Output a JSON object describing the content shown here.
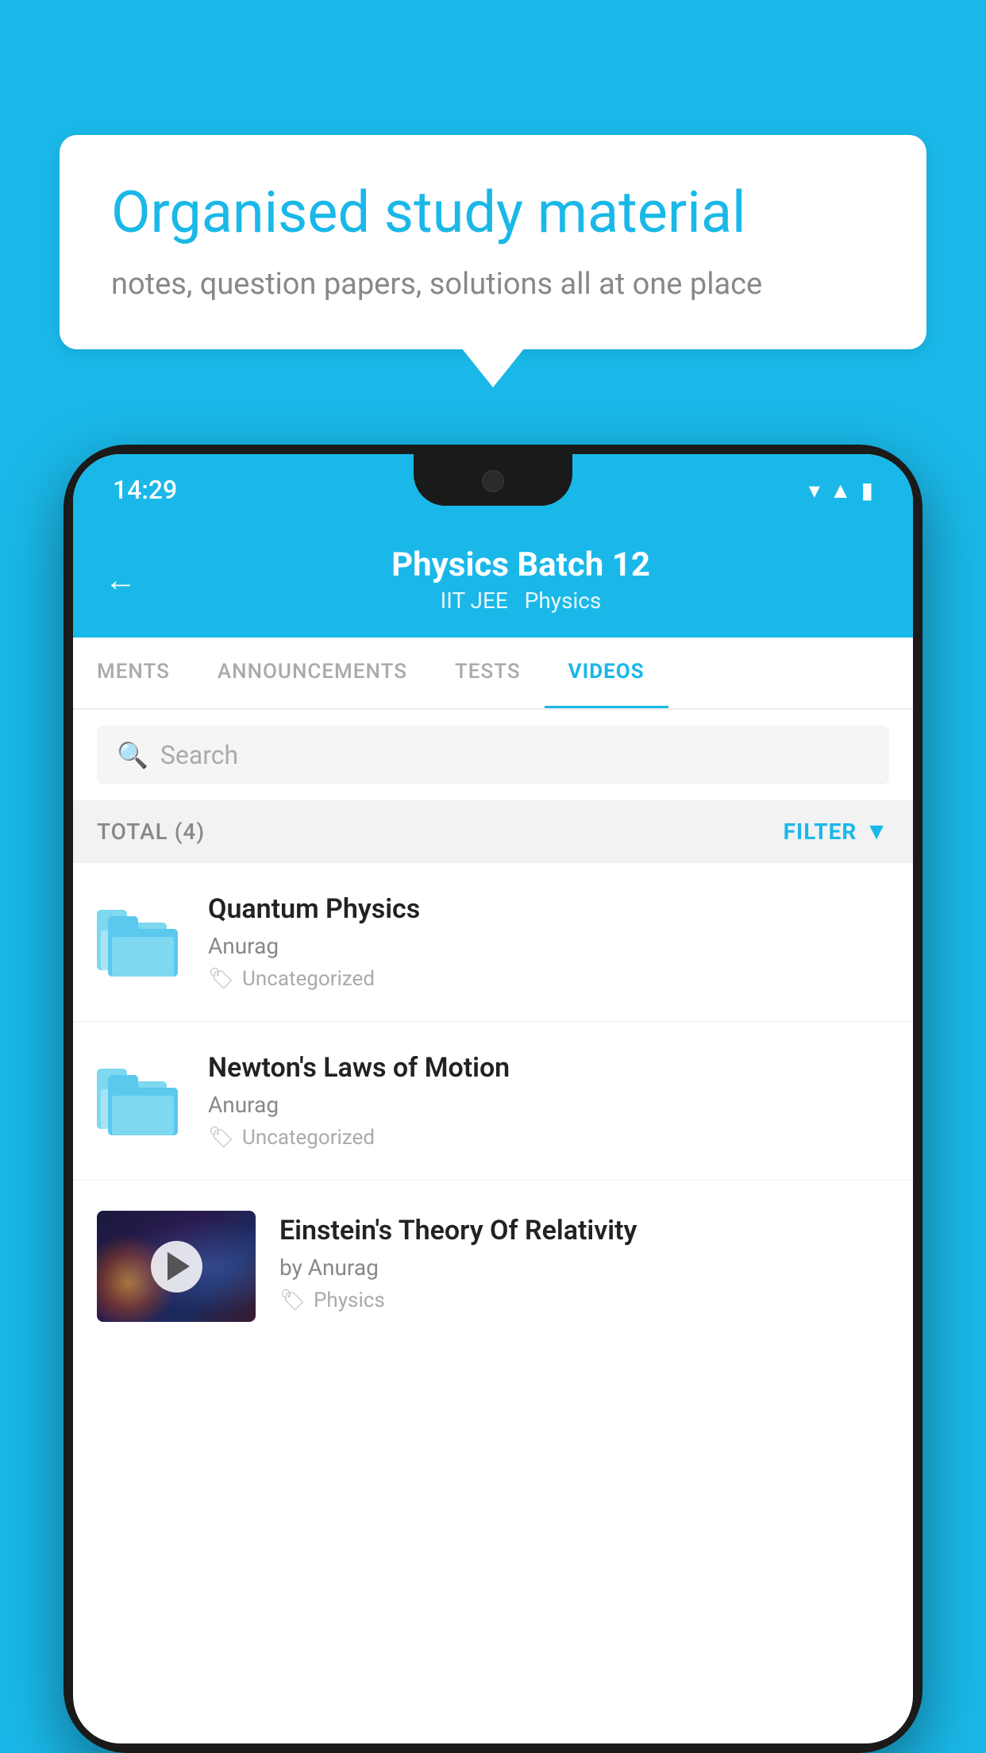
{
  "background": {
    "color": "#1ab8e8"
  },
  "speech_bubble": {
    "title": "Organised study material",
    "subtitle": "notes, question papers, solutions all at one place"
  },
  "phone": {
    "status_bar": {
      "time": "14:29"
    },
    "header": {
      "back_label": "←",
      "title": "Physics Batch 12",
      "subtitle_part1": "IIT JEE",
      "subtitle_part2": "Physics"
    },
    "tabs": [
      {
        "label": "MENTS",
        "active": false
      },
      {
        "label": "ANNOUNCEMENTS",
        "active": false
      },
      {
        "label": "TESTS",
        "active": false
      },
      {
        "label": "VIDEOS",
        "active": true
      }
    ],
    "search": {
      "placeholder": "Search"
    },
    "filter_bar": {
      "total_label": "TOTAL (4)",
      "filter_label": "FILTER"
    },
    "videos": [
      {
        "title": "Quantum Physics",
        "author": "Anurag",
        "tag": "Uncategorized",
        "has_thumbnail": false
      },
      {
        "title": "Newton's Laws of Motion",
        "author": "Anurag",
        "tag": "Uncategorized",
        "has_thumbnail": false
      },
      {
        "title": "Einstein's Theory Of Relativity",
        "author": "by Anurag",
        "tag": "Physics",
        "has_thumbnail": true
      }
    ]
  }
}
